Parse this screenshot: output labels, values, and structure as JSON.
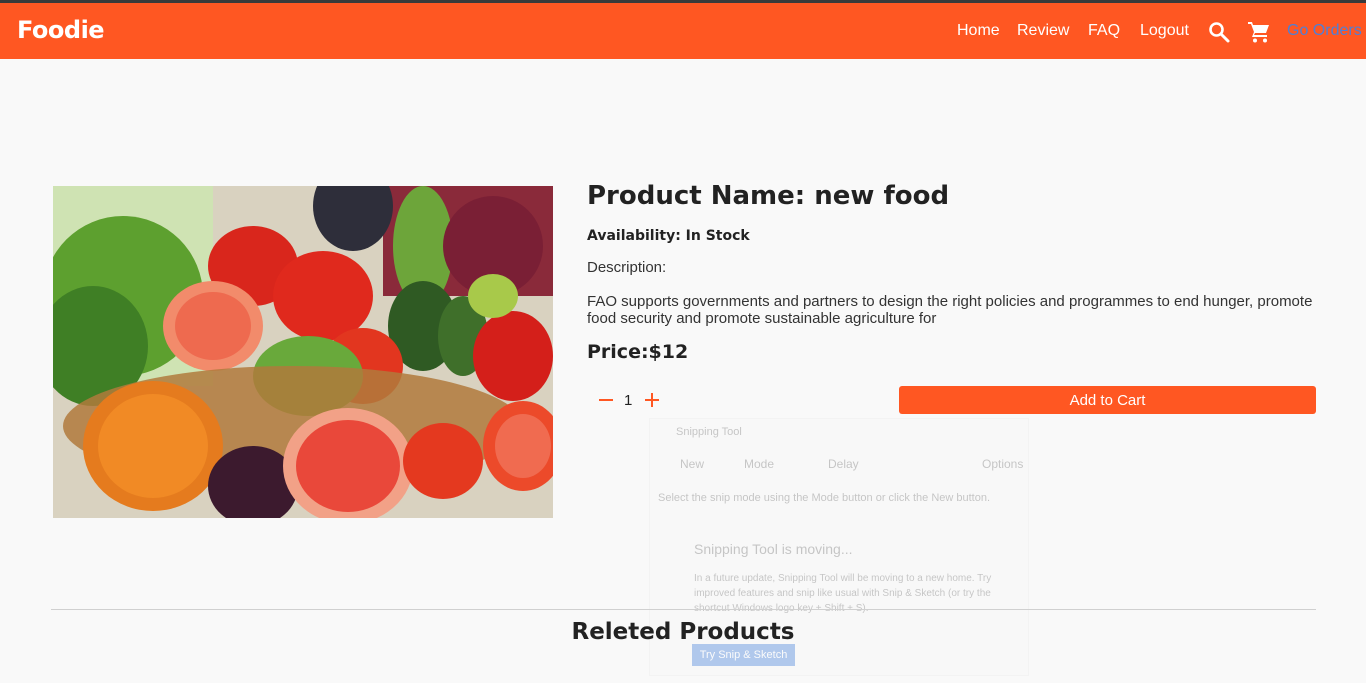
{
  "nav": {
    "brand": "Foodie",
    "links": [
      "Home",
      "Review",
      "FAQ",
      "Logout"
    ],
    "orders_label": "Go Orders",
    "icons": [
      "search-icon",
      "cart-icon"
    ]
  },
  "product": {
    "title": "Product Name: new food",
    "availability": "Availability: In Stock",
    "description_label": "Description:",
    "description": "FAO supports governments and partners to design the right policies and programmes to end hunger, promote food security and promote sustainable agriculture for",
    "price": "Price:$12",
    "quantity": "1",
    "add_to_cart_label": "Add to Cart"
  },
  "snipping_tool": {
    "title": "Snipping Tool",
    "new_label": "New",
    "mode_label": "Mode",
    "delay_label": "Delay",
    "options_label": "Options",
    "hint": "Select the snip mode using the Mode button or click the New button.",
    "moving_title": "Snipping Tool is moving...",
    "moving_body": "In a future update, Snipping Tool will be moving to a new home. Try improved features and snip like usual with Snip & Sketch (or try the shortcut Windows logo key + Shift + S).",
    "button_label": "Try Snip & Sketch"
  },
  "related": {
    "title": "Releted Products"
  },
  "colors": {
    "accent": "#ff5722",
    "link_blue": "#4f7fd6",
    "background": "#f9f9f9"
  }
}
